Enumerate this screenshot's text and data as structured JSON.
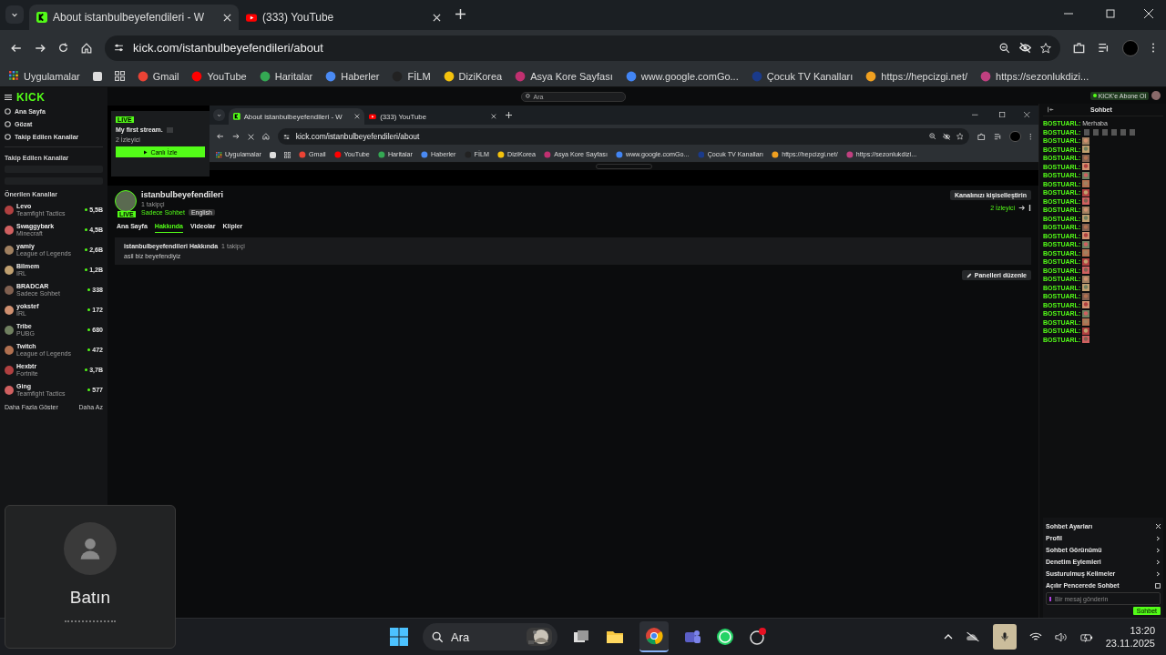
{
  "browser": {
    "tabs": [
      {
        "title": "About istanbulbeyefendileri - W",
        "selected": true
      },
      {
        "title": "(333) YouTube",
        "selected": false
      }
    ],
    "url": "kick.com/istanbulbeyefendileri/about",
    "loading": false,
    "bookmarks": [
      "Uygulamalar",
      "Gmail",
      "YouTube",
      "Haritalar",
      "Haberler",
      "FİLM",
      "DiziKorea",
      "Asya Kore Sayfası",
      "www.google.comGo...",
      "Çocuk TV Kanalları",
      "https://hepcizgi.net/",
      "https://sezonlukdizi..."
    ]
  },
  "kick": {
    "logo": "KICK",
    "search": {
      "placeholder": "Ara"
    },
    "nav": [
      {
        "label": "Ana Sayfa"
      },
      {
        "label": "Gözat"
      },
      {
        "label": "Takip Edilen Kanallar"
      }
    ],
    "followed_heading": "Takip Edilen Kanallar",
    "recommended_heading": "Önerilen Kanallar",
    "channels": [
      {
        "name": "Levo",
        "category": "Teamfight Tactics",
        "viewers": "5,5B"
      },
      {
        "name": "Swaggybark",
        "category": "Minecraft",
        "viewers": "4,5B"
      },
      {
        "name": "yamiy",
        "category": "League of Legends",
        "viewers": "2,6B"
      },
      {
        "name": "Bilmem",
        "category": "IRL",
        "viewers": "1,2B"
      },
      {
        "name": "BRADCAR",
        "category": "Sadece Sohbet",
        "viewers": "338"
      },
      {
        "name": "yokstef",
        "category": "IRL",
        "viewers": "172"
      },
      {
        "name": "Tribe",
        "category": "PUBG",
        "viewers": "680"
      },
      {
        "name": "Twitch",
        "category": "League of Legends",
        "viewers": "472"
      },
      {
        "name": "Hexbtr",
        "category": "Fortnite",
        "viewers": "3,7B"
      },
      {
        "name": "Ging",
        "category": "Teamfight Tactics",
        "viewers": "577"
      }
    ],
    "show_more": "Daha Fazla Göster",
    "show_less": "Daha Az",
    "preview": {
      "badge": "LIVE",
      "title": "My first stream.",
      "viewers": "2 İzleyici",
      "button": "Canlı İzle"
    },
    "channel": {
      "name": "istanbulbeyefendileri",
      "followers": "1 takipçi",
      "category": "Sadece Sohbet",
      "language": "English",
      "badge": "LIVE",
      "customize_button": "Kanalınızı kişiselleştirin",
      "viewers": "2 İzleyici"
    },
    "tabs": [
      {
        "label": "Ana Sayfa",
        "selected": false
      },
      {
        "label": "Hakkında",
        "selected": true
      },
      {
        "label": "Videolar",
        "selected": false
      },
      {
        "label": "Klipler",
        "selected": false
      }
    ],
    "about": {
      "title": "istanbulbeyefendileri Hakkında",
      "followers": "1 takipçi",
      "text": "asil biz beyefendiyiz"
    },
    "edit_panels_button": "Panelleri düzenle",
    "top_button": "KICK'e Abone Ol"
  },
  "nested_browser": {
    "tabs": [
      {
        "title": "About istanbulbeyefendileri - W",
        "selected": true
      },
      {
        "title": "(333) YouTube",
        "selected": false
      }
    ],
    "url": "kick.com/istanbulbeyefendileri/about",
    "loading": true,
    "bookmarks": [
      "Uygulamalar",
      "Gmail",
      "YouTube",
      "Haritalar",
      "Haberler",
      "FİLM",
      "DiziKorea",
      "Asya Kore Sayfası",
      "www.google.comGo...",
      "Çocuk TV Kanalları",
      "https://hepcizgi.net/",
      "https://sezonlukdizi..."
    ]
  },
  "chat": {
    "title": "Sohbet",
    "messages": [
      {
        "user": "BOSTUARL:",
        "kind": "text",
        "text": "Merhaba"
      },
      {
        "user": "BOSTUARL:",
        "kind": "emote_row"
      },
      {
        "user": "BOSTUARL:",
        "kind": "emote"
      },
      {
        "user": "BOSTUARL:",
        "kind": "emote"
      },
      {
        "user": "BOSTUARL:",
        "kind": "emote"
      },
      {
        "user": "BOSTUARL:",
        "kind": "emote"
      },
      {
        "user": "BOSTUARL:",
        "kind": "emote"
      },
      {
        "user": "BOSTUARL:",
        "kind": "emote"
      },
      {
        "user": "BOSTUARL:",
        "kind": "emote"
      },
      {
        "user": "BOSTUARL:",
        "kind": "emote"
      },
      {
        "user": "BOSTUARL:",
        "kind": "emote"
      },
      {
        "user": "BOSTUARL:",
        "kind": "emote"
      },
      {
        "user": "BOSTUARL:",
        "kind": "emote"
      },
      {
        "user": "BOSTUARL:",
        "kind": "emote"
      },
      {
        "user": "BOSTUARL:",
        "kind": "emote"
      },
      {
        "user": "BOSTUARL:",
        "kind": "emote"
      },
      {
        "user": "BOSTUARL:",
        "kind": "emote"
      },
      {
        "user": "BOSTUARL:",
        "kind": "emote"
      },
      {
        "user": "BOSTUARL:",
        "kind": "emote"
      },
      {
        "user": "BOSTUARL:",
        "kind": "emote"
      },
      {
        "user": "BOSTUARL:",
        "kind": "emote"
      },
      {
        "user": "BOSTUARL:",
        "kind": "emote"
      },
      {
        "user": "BOSTUARL:",
        "kind": "emote"
      },
      {
        "user": "BOSTUARL:",
        "kind": "emote"
      },
      {
        "user": "BOSTUARL:",
        "kind": "emote"
      },
      {
        "user": "BOSTUARL:",
        "kind": "emote"
      }
    ],
    "settings": {
      "title": "Sohbet Ayarları",
      "items": [
        {
          "label": "Profil",
          "kind": "submenu"
        },
        {
          "label": "Sohbet Görünümü",
          "kind": "submenu"
        },
        {
          "label": "Denetim Eylemleri",
          "kind": "submenu"
        },
        {
          "label": "Susturulmuş Kelimeler",
          "kind": "submenu"
        },
        {
          "label": "Açılır Pencerede Sohbet",
          "kind": "external"
        }
      ]
    },
    "input": {
      "placeholder": "Bir mesaj gönderin"
    },
    "send_button": "Sohbet"
  },
  "call_tile": {
    "name": "Batın"
  },
  "taskbar": {
    "search": {
      "placeholder": "Ara"
    },
    "time": "13:20",
    "date": "23.11.2025"
  }
}
